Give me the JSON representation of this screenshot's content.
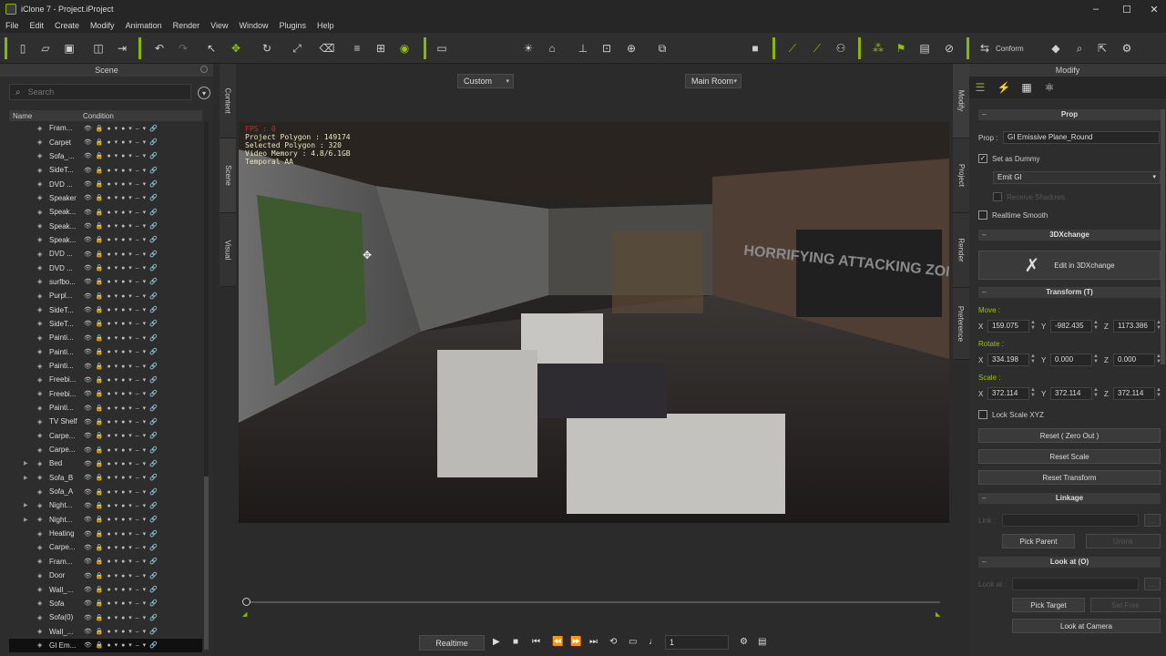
{
  "window": {
    "title": "iClone 7 - Project.iProject",
    "minimize": "–",
    "maximize": "☐",
    "close": "✕"
  },
  "menu": [
    "File",
    "Edit",
    "Create",
    "Modify",
    "Animation",
    "Render",
    "View",
    "Window",
    "Plugins",
    "Help"
  ],
  "toolbar": {
    "custom_label": "Custom",
    "main_room_label": "Main Room",
    "conform_label": "Conform"
  },
  "scene": {
    "title": "Scene",
    "search_placeholder": "Search",
    "col_name": "Name",
    "col_condition": "Condition",
    "condition_icons": "👁 🔒 ● ▾ ● ▾ – ▾ 🔗",
    "items": [
      {
        "label": "Fram...",
        "expand": false
      },
      {
        "label": "Carpet",
        "expand": false
      },
      {
        "label": "Sofa_...",
        "expand": false
      },
      {
        "label": "SideT...",
        "expand": false
      },
      {
        "label": "DVD ...",
        "expand": false
      },
      {
        "label": "Speaker",
        "expand": false
      },
      {
        "label": "Speak...",
        "expand": false
      },
      {
        "label": "Speak...",
        "expand": false
      },
      {
        "label": "Speak...",
        "expand": false
      },
      {
        "label": "DVD ...",
        "expand": false
      },
      {
        "label": "DVD ...",
        "expand": false
      },
      {
        "label": "surfbo...",
        "expand": false
      },
      {
        "label": "Purpl...",
        "expand": false
      },
      {
        "label": "SideT...",
        "expand": false
      },
      {
        "label": "SideT...",
        "expand": false
      },
      {
        "label": "Painti...",
        "expand": false
      },
      {
        "label": "Painti...",
        "expand": false
      },
      {
        "label": "Painti...",
        "expand": false
      },
      {
        "label": "Freebi...",
        "expand": false
      },
      {
        "label": "Freebi...",
        "expand": false
      },
      {
        "label": "Painti...",
        "expand": false
      },
      {
        "label": "TV Shelf",
        "expand": false
      },
      {
        "label": "Carpe...",
        "expand": false
      },
      {
        "label": "Carpe...",
        "expand": false
      },
      {
        "label": "Bed",
        "expand": true
      },
      {
        "label": "Sofa_B",
        "expand": true
      },
      {
        "label": "Sofa_A",
        "expand": false
      },
      {
        "label": "Night...",
        "expand": true
      },
      {
        "label": "Night...",
        "expand": true
      },
      {
        "label": "Heating",
        "expand": false
      },
      {
        "label": "Carpe...",
        "expand": false
      },
      {
        "label": "Fram...",
        "expand": false
      },
      {
        "label": "Door",
        "expand": false
      },
      {
        "label": "Wall_...",
        "expand": false
      },
      {
        "label": "Sofa",
        "expand": false
      },
      {
        "label": "Sofa(0)",
        "expand": false
      },
      {
        "label": "Wall_...",
        "expand": false
      },
      {
        "label": "GI Em...",
        "expand": false,
        "selected": true
      }
    ]
  },
  "side_tabs_left": [
    "Content",
    "Scene",
    "Visual"
  ],
  "side_tabs_right": [
    "Modify",
    "Project",
    "Render",
    "Preference"
  ],
  "viewport": {
    "fps": "FPS : 0",
    "polygons": "Project Polygon : 149174",
    "selected": "Selected Polygon : 320",
    "memory": "Video Memory : 4.8/6.1GB",
    "aa": "Temporal AA",
    "poster_text": "HORRIFYING ATTACKING ZOMBIES"
  },
  "transport": {
    "realtime": "Realtime",
    "frame": "1"
  },
  "modify": {
    "title": "Modify",
    "prop_section": "Prop",
    "prop_label": "Prop :",
    "prop_name": "GI Emissive Plane_Round",
    "set_as_dummy": "Set as Dummy",
    "emit_gi": "Emit GI",
    "receive_shadows": "Receive Shadows",
    "realtime_smooth": "Realtime Smooth",
    "xchange_section": "3DXchange",
    "edit_3dxchange": "Edit in 3DXchange",
    "transform_section": "Transform  (T)",
    "move_label": "Move :",
    "rotate_label": "Rotate :",
    "scale_label": "Scale :",
    "move": {
      "x": "159.075",
      "y": "-982.435",
      "z": "1173.386"
    },
    "rotate": {
      "x": "334.198",
      "y": "0.000",
      "z": "0.000"
    },
    "scale": {
      "x": "372.114",
      "y": "372.114",
      "z": "372.114"
    },
    "lock_scale": "Lock Scale XYZ",
    "reset_zero": "Reset ( Zero Out )",
    "reset_scale": "Reset Scale",
    "reset_transform": "Reset Transform",
    "linkage_section": "Linkage",
    "link_label": "Link :",
    "pick_parent": "Pick Parent",
    "unlink": "Unlink",
    "lookat_section": "Look at  (O)",
    "lookat_label": "Look at :",
    "pick_target": "Pick Target",
    "set_free": "Set Free",
    "look_at_camera": "Look at Camera",
    "more_btn": "..."
  },
  "colors": {
    "accent": "#8ab800",
    "panel": "#2d2d2d",
    "bg": "#2b2b2b"
  }
}
